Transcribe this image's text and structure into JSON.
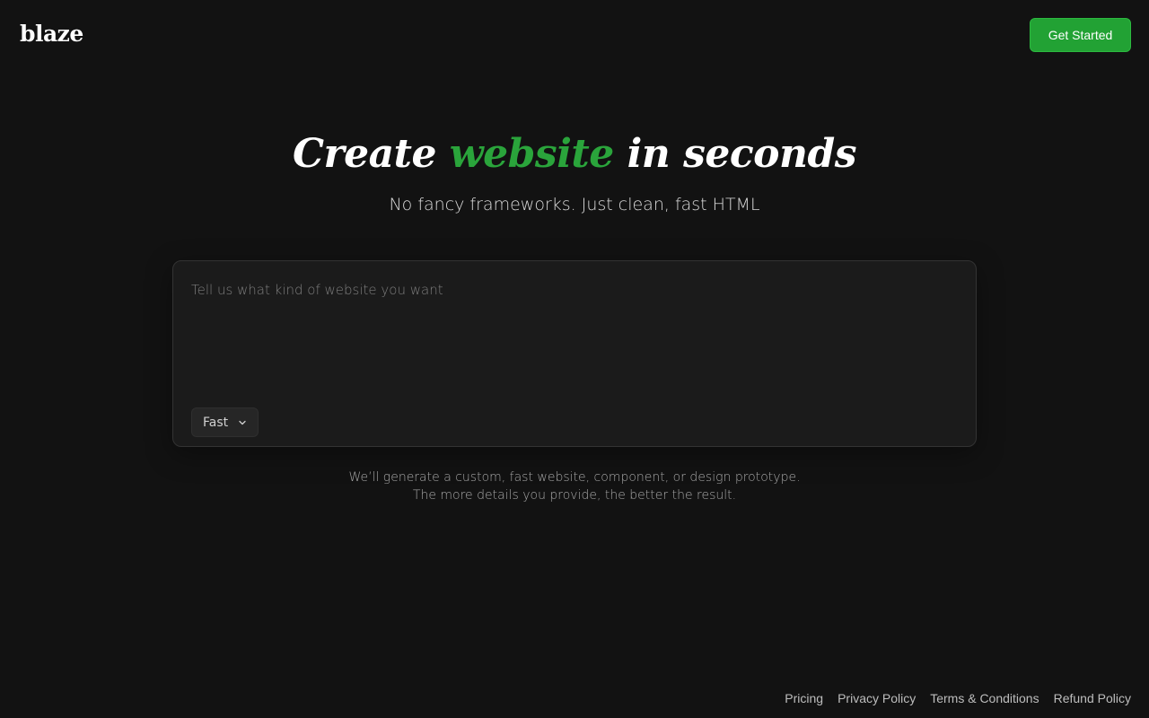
{
  "header": {
    "logo": "blaze",
    "cta_label": "Get Started"
  },
  "hero": {
    "title_prefix": "Create ",
    "title_accent": "website",
    "title_suffix": " in seconds",
    "subtitle": "No fancy frameworks. Just clean, fast HTML"
  },
  "prompt": {
    "placeholder": "Tell us what kind of website you want",
    "value": "",
    "mode_selected": "Fast",
    "mode_icon": "chevron-down-icon"
  },
  "helper": {
    "line1": "We’ll generate a custom, fast website, component, or design prototype.",
    "line2": "The more details you provide, the better the result."
  },
  "footer": {
    "links": [
      "Pricing",
      "Privacy Policy",
      "Terms & Conditions",
      "Refund Policy"
    ]
  },
  "colors": {
    "background": "#121212",
    "accent": "#22a234",
    "panel": "#1b1b1b"
  }
}
